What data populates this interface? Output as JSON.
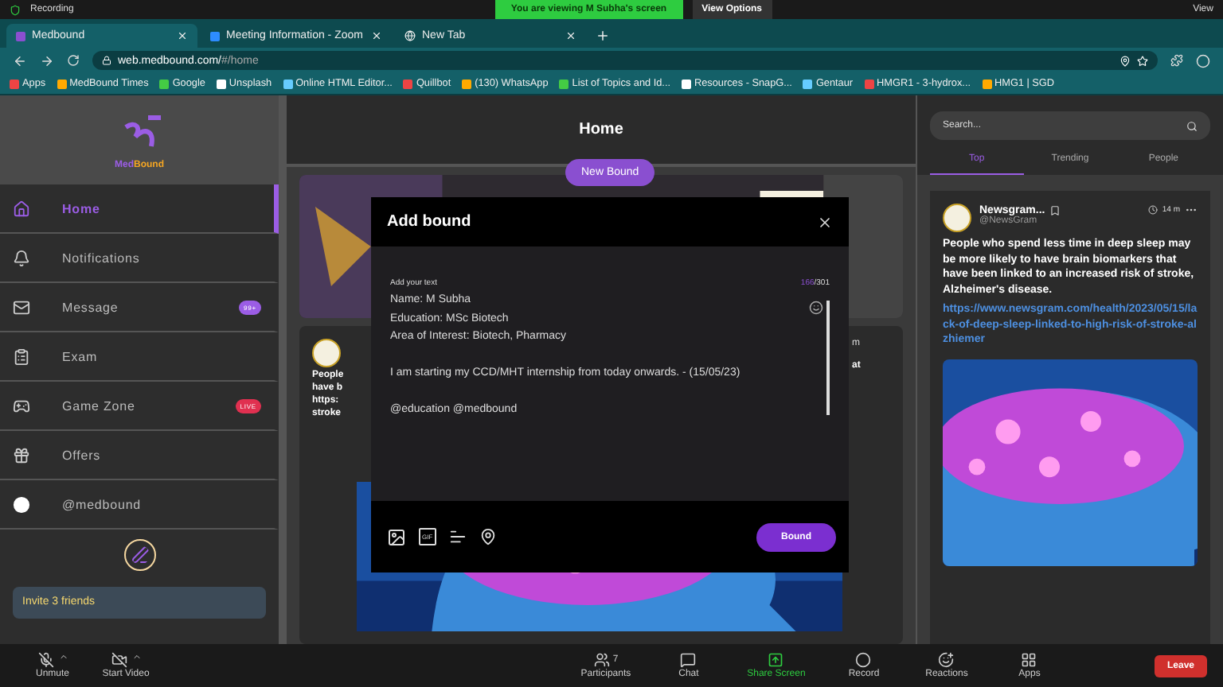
{
  "zoom_top": {
    "recording": "Recording",
    "viewing": "You are viewing M Subha's screen",
    "view_options": "View Options",
    "view": "View"
  },
  "browser_tabs": [
    {
      "label": "Medbound",
      "selected": true,
      "kind": "medbound"
    },
    {
      "label": "Meeting Information - Zoom",
      "selected": false,
      "kind": "zoom"
    },
    {
      "label": "New Tab",
      "selected": false,
      "kind": "globe"
    }
  ],
  "address": {
    "url": "web.medbound.com/",
    "path": "#/home"
  },
  "bookmarks": [
    "Apps",
    "MedBound Times",
    "Google",
    "Unsplash",
    "Online HTML Editor...",
    "Quillbot",
    "(130) WhatsApp",
    "List of Topics and Id...",
    "Resources - SnapG...",
    "Gentaur",
    "HMGR1 - 3-hydrox...",
    "HMG1 | SGD"
  ],
  "logo": {
    "first": "Med",
    "second": "Bound"
  },
  "sidebar": {
    "items": [
      {
        "label": "Home",
        "selected": true,
        "kind": "home"
      },
      {
        "label": "Notifications",
        "selected": false,
        "kind": "bell"
      },
      {
        "label": "Message",
        "selected": false,
        "kind": "mail",
        "badge": "99+"
      },
      {
        "label": "Exam",
        "selected": false,
        "kind": "exam"
      },
      {
        "label": "Game Zone",
        "selected": false,
        "kind": "game",
        "badge": "LIVE"
      },
      {
        "label": "Offers",
        "selected": false,
        "kind": "gift"
      },
      {
        "label": "@medbound",
        "selected": false,
        "kind": "profile"
      }
    ],
    "invite": "Invite 3 friends"
  },
  "feed": {
    "title": "Home",
    "new_bound": "New Bound",
    "post_time": "m",
    "left_fragments": [
      "People",
      "have b",
      "https:",
      "stroke"
    ],
    "right_fragment": "at"
  },
  "modal": {
    "title": "Add bound",
    "label": "Add your text",
    "count": "166",
    "max": "/301",
    "value": "Name: M Subha\nEducation: MSc Biotech\nArea of Interest: Biotech, Pharmacy\n\nI am starting my CCD/MHT internship from today onwards. - (15/05/23)\n\n@education @medbound",
    "gif": "GIF",
    "submit": "Bound"
  },
  "right": {
    "search_placeholder": "Search...",
    "tabs": [
      {
        "label": "Top",
        "selected": true
      },
      {
        "label": "Trending",
        "selected": false
      },
      {
        "label": "People",
        "selected": false
      }
    ],
    "post": {
      "author": "Newsgram...",
      "handle": "@NewsGram",
      "time": "14 m",
      "text": "People who spend less time in deep sleep may be more likely to have brain biomarkers that have been linked to an increased risk of stroke, Alzheimer's disease.",
      "link": "https://www.newsgram.com/health/2023/05/15/lack-of-deep-sleep-linked-to-high-risk-of-stroke-alzhiemer"
    }
  },
  "zoom_bar": {
    "controls": [
      {
        "label": "Unmute",
        "kind": "mic"
      },
      {
        "label": "Start Video",
        "kind": "video"
      }
    ],
    "center": [
      {
        "label": "Participants",
        "kind": "people",
        "count": "7"
      },
      {
        "label": "Chat",
        "kind": "chat"
      },
      {
        "label": "Share Screen",
        "kind": "share"
      },
      {
        "label": "Record",
        "kind": "record"
      },
      {
        "label": "Reactions",
        "kind": "react"
      },
      {
        "label": "Apps",
        "kind": "apps"
      }
    ],
    "leave": "Leave"
  }
}
